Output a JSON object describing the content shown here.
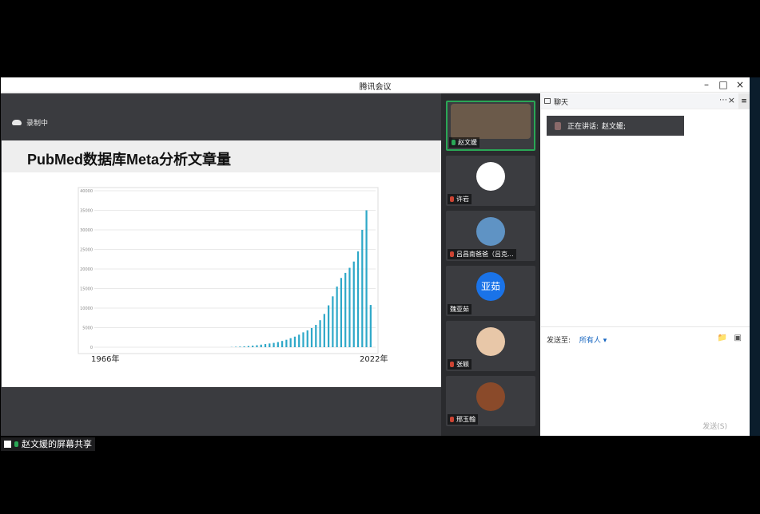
{
  "window": {
    "title": "腾讯会议"
  },
  "share": {
    "recording_label": "录制中",
    "slide_title": "PubMed数据库Meta分析文章量",
    "sharer_label": "赵文媛的屏幕共享"
  },
  "chart_data": {
    "type": "bar",
    "title": "",
    "xlabel": "",
    "ylabel": "",
    "x_start_label": "1966年",
    "x_end_label": "2022年",
    "ylim": [
      0,
      40000
    ],
    "yticks": [
      0,
      5000,
      10000,
      15000,
      20000,
      25000,
      30000,
      35000,
      40000
    ],
    "grid": true,
    "bar_color": "#2ea8c8",
    "values": [
      0,
      0,
      0,
      0,
      0,
      0,
      0,
      0,
      0,
      0,
      0,
      0,
      0,
      0,
      0,
      0,
      0,
      0,
      0,
      0,
      0,
      0,
      0,
      0,
      0,
      0,
      0,
      0,
      0,
      0,
      0,
      0,
      50,
      100,
      150,
      200,
      300,
      400,
      500,
      650,
      800,
      950,
      1100,
      1300,
      1600,
      1900,
      2300,
      2700,
      3200,
      3800,
      4300,
      4900,
      5700,
      6900,
      8500,
      10700,
      13000,
      15500,
      17700,
      19000,
      20300,
      21900,
      24500,
      30000,
      35000,
      10800
    ]
  },
  "participants": [
    {
      "name": "赵文媛",
      "mic": "on",
      "active": true
    },
    {
      "name": "许岩",
      "mic": "muted"
    },
    {
      "name": "吕昌南爸爸（吕克...",
      "mic": "muted"
    },
    {
      "name": "魏亚茹",
      "avatar_text": "亚茹"
    },
    {
      "name": "张颖",
      "mic": "muted"
    },
    {
      "name": "邢玉翰",
      "mic": "muted"
    }
  ],
  "chat": {
    "title": "聊天",
    "speaking_prefix": "正在讲话:",
    "speaking_name": "赵文媛;",
    "send_to_label": "发送至:",
    "send_to_target": "所有人",
    "send_button": "发送(S)"
  },
  "colors": {
    "accent": "#1565c0",
    "active_border": "#2aa756",
    "avatar_blue": "#1a73e8"
  }
}
